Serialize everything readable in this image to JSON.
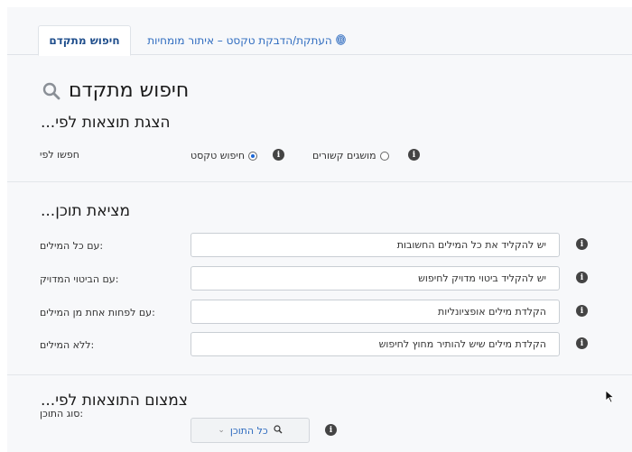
{
  "tabs": {
    "active_label": "חיפוש מתקדם",
    "other_label": "העתקת/הדבקת טקסט – איתור מומחיות",
    "other_icon": "fingerprint-icon"
  },
  "title": "חיפוש מתקדם",
  "display_section": {
    "heading": "...הצגת תוצאות לפי",
    "search_by_label": "חפשו לפי",
    "options": [
      {
        "label": "חיפוש טקסט",
        "checked": true
      },
      {
        "label": "מושגים קשורים",
        "checked": false
      }
    ]
  },
  "content_section": {
    "heading": "...מציאת תוכן",
    "rows": [
      {
        "label": ":עם כל המילים",
        "placeholder": "יש להקליד את כל המילים החשובות"
      },
      {
        "label": ":עם הביטוי המדויק",
        "placeholder": "יש להקליד ביטוי מדויק לחיפוש"
      },
      {
        "label": ":עם לפחות אחת מן המילים",
        "placeholder": "הקלדת מילים אופציונליות"
      },
      {
        "label": ":ללא המילים",
        "placeholder": "הקלדת מילים שיש להותיר מחוץ לחיפוש"
      }
    ]
  },
  "filter_section": {
    "heading": "...צמצום התוצאות לפי",
    "content_type_label": ":סוג התוכן",
    "content_type_value": "כל התוכן"
  },
  "colors": {
    "accent": "#2e6bbf",
    "active_tab_text": "#1f4e8c",
    "background": "#f7f8fa"
  }
}
